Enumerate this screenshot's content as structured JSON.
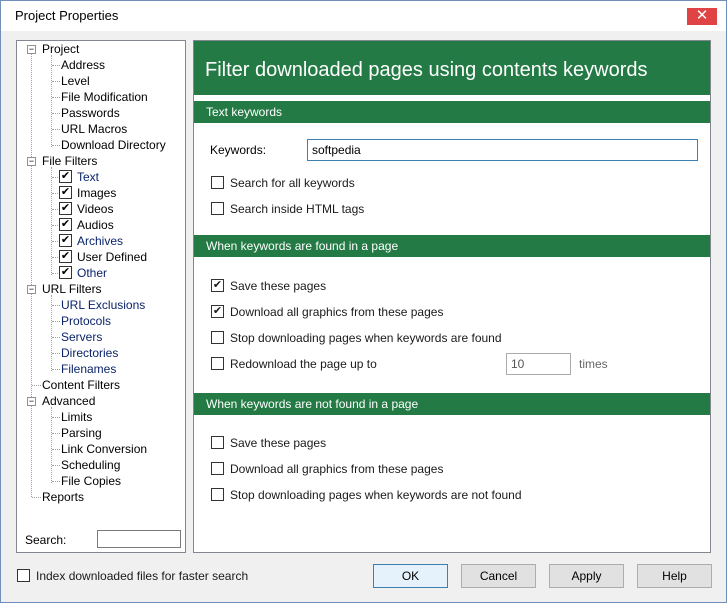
{
  "window": {
    "title": "Project Properties",
    "close_glyph": "✕"
  },
  "tree": {
    "project": {
      "label": "Project",
      "children": [
        "Address",
        "Level",
        "File Modification",
        "Passwords",
        "URL Macros",
        "Download Directory"
      ]
    },
    "file_filters": {
      "label": "File Filters",
      "children": [
        {
          "label": "Text",
          "checked": true
        },
        {
          "label": "Images",
          "checked": true
        },
        {
          "label": "Videos",
          "checked": true
        },
        {
          "label": "Audios",
          "checked": true
        },
        {
          "label": "Archives",
          "checked": true
        },
        {
          "label": "User Defined",
          "checked": true
        },
        {
          "label": "Other",
          "checked": true
        }
      ]
    },
    "url_filters": {
      "label": "URL Filters",
      "children": [
        "URL Exclusions",
        "Protocols",
        "Servers",
        "Directories",
        "Filenames"
      ]
    },
    "content_filters": {
      "label": "Content Filters"
    },
    "advanced": {
      "label": "Advanced",
      "children": [
        "Limits",
        "Parsing",
        "Link Conversion",
        "Scheduling",
        "File Copies"
      ]
    },
    "reports": {
      "label": "Reports"
    },
    "expander_glyph": "−",
    "check_glyph": "✔"
  },
  "search": {
    "label": "Search:",
    "value": ""
  },
  "panel": {
    "title": "Filter downloaded pages using contents keywords",
    "text_keywords": {
      "heading": "Text keywords",
      "keywords_label": "Keywords:",
      "keywords_value": "softpedia",
      "options": [
        {
          "label": "Search for all keywords",
          "checked": false
        },
        {
          "label": "Search inside HTML tags",
          "checked": false
        }
      ]
    },
    "found": {
      "heading": "When keywords are found in a page",
      "options": [
        {
          "label": "Save these pages",
          "checked": true
        },
        {
          "label": "Download all graphics from these pages",
          "checked": true
        },
        {
          "label": "Stop downloading pages when keywords are found",
          "checked": false
        },
        {
          "label": "Redownload the page up to",
          "checked": false
        }
      ],
      "times_value": "10",
      "times_label": "times"
    },
    "not_found": {
      "heading": "When keywords are not found in a page",
      "options": [
        {
          "label": "Save these pages",
          "checked": false
        },
        {
          "label": "Download all graphics from these pages",
          "checked": false
        },
        {
          "label": "Stop downloading pages when keywords are not found",
          "checked": false
        }
      ]
    }
  },
  "footer": {
    "index_label": "Index downloaded files for faster search",
    "index_checked": false,
    "ok": "OK",
    "cancel": "Cancel",
    "apply": "Apply",
    "help": "Help"
  }
}
